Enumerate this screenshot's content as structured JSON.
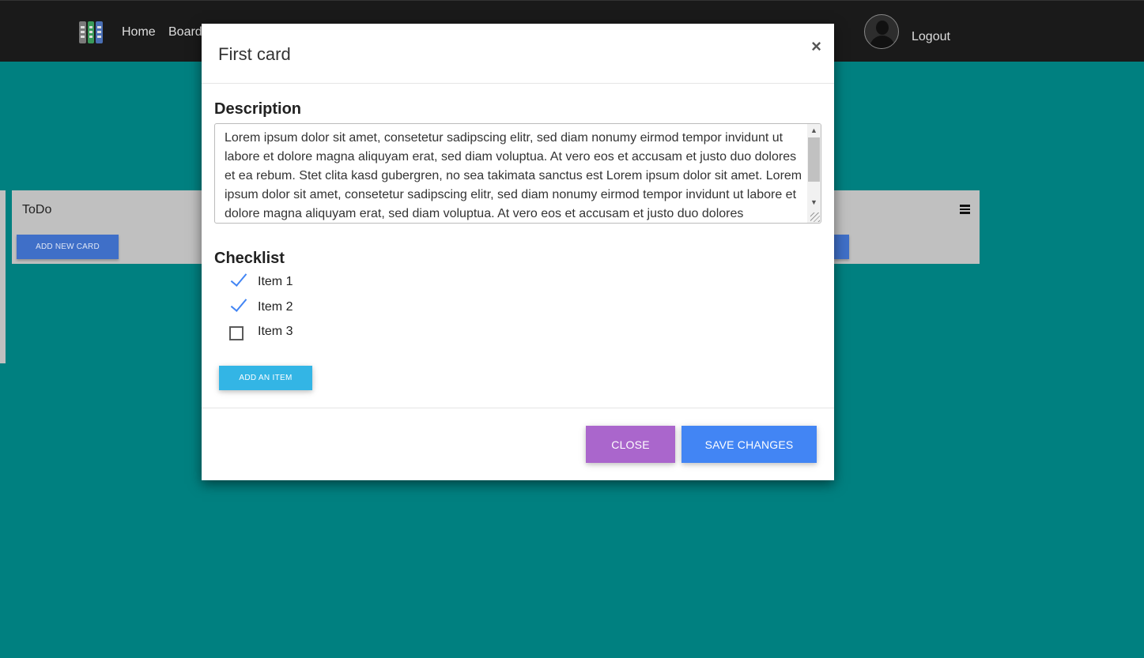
{
  "colors": {
    "page_background": "#008080",
    "navbar": "#1a1a1a",
    "column_background": "#c0c0c0",
    "close_button": "#aa66cc",
    "save_button": "#4285f4",
    "add_item_button": "#33b5e5",
    "check_mark": "#4285f4"
  },
  "navbar": {
    "logo_icon": "board-logo-icon",
    "links": [
      "Home",
      "Board"
    ],
    "user_icon": "user-avatar-icon",
    "logout_label": "Logout"
  },
  "board": {
    "columns": [
      {
        "title": "ToDo",
        "add_button_label": "ADD NEW CARD",
        "menu_icon": "hamburger-menu-icon"
      }
    ]
  },
  "modal": {
    "title": "First card",
    "close_icon": "×",
    "description_heading": "Description",
    "description_text": "Lorem ipsum dolor sit amet, consetetur sadipscing elitr, sed diam nonumy eirmod tempor invidunt ut labore et dolore magna aliquyam erat, sed diam voluptua. At vero eos et accusam et justo duo dolores et ea rebum. Stet clita kasd gubergren, no sea takimata sanctus est Lorem ipsum dolor sit amet. Lorem ipsum dolor sit amet, consetetur sadipscing elitr, sed diam nonumy eirmod tempor invidunt ut labore et dolore magna aliquyam erat, sed diam voluptua. At vero eos et accusam et justo duo dolores",
    "checklist_heading": "Checklist",
    "checklist_items": [
      {
        "label": "Item 1",
        "checked": true
      },
      {
        "label": "Item 2",
        "checked": true
      },
      {
        "label": "Item 3",
        "checked": false
      }
    ],
    "add_item_label": "ADD AN ITEM",
    "close_label": "CLOSE",
    "save_label": "SAVE CHANGES"
  }
}
